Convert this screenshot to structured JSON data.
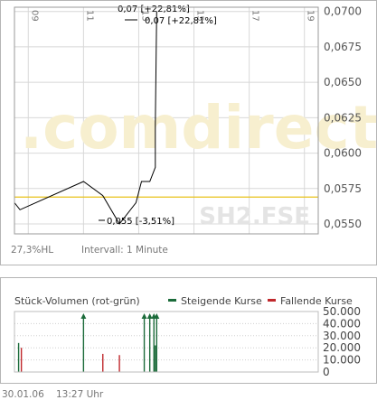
{
  "price_panel": {
    "watermark": ".comdirect",
    "symbol": "SH2.FSE",
    "hl_label": "27,3%HL",
    "interval_label": "Intervall: 1 Minute",
    "annotation_high_1": "0,07 [+22,81%]",
    "annotation_high_2": "0,07 [+22,81%]",
    "annotation_low": "0,055 [-3,51%]"
  },
  "volume_panel": {
    "title": "Stück-Volumen (rot-grün)",
    "legend_up": "Steigende Kurse",
    "legend_down": "Fallende Kurse"
  },
  "footer": {
    "date": "30.01.06",
    "time": "13:27 Uhr"
  },
  "colors": {
    "price_line": "#000000",
    "reference_line": "#e8c21a",
    "up": "#1b6b3a",
    "down": "#c0282c",
    "grid": "#d8d8d8",
    "frame": "#9a9a9a",
    "watermark_gold": "#f6ecc4",
    "watermark_gray": "#ebebeb"
  },
  "chart_data": [
    {
      "type": "line",
      "x_ticks": [
        "09",
        "11",
        "13",
        "15",
        "17",
        "19"
      ],
      "x_range": [
        8.5,
        19.5
      ],
      "y_ticks": [
        "0,0700",
        "0,0675",
        "0,0650",
        "0,0625",
        "0,0600",
        "0,0575",
        "0,0550"
      ],
      "ylim": [
        0.0543,
        0.0703
      ],
      "reference_value": 0.0569,
      "series": [
        {
          "x": [
            8.5,
            8.7,
            11.0,
            11.7,
            12.3,
            12.9,
            13.1,
            13.4,
            13.6,
            13.6,
            13.65
          ],
          "y": [
            0.0565,
            0.056,
            0.058,
            0.057,
            0.055,
            0.0565,
            0.058,
            0.058,
            0.059,
            0.062,
            0.07
          ]
        }
      ]
    },
    {
      "type": "bar",
      "y_ticks": [
        "50.000",
        "40.000",
        "30.000",
        "20.000",
        "10.000",
        "0"
      ],
      "ylim": [
        0,
        50000
      ],
      "bars": [
        {
          "x": 8.65,
          "value": 24000,
          "dir": "up"
        },
        {
          "x": 8.75,
          "value": 20000,
          "dir": "down"
        },
        {
          "x": 11.0,
          "value": 47000,
          "dir": "up"
        },
        {
          "x": 11.7,
          "value": 15000,
          "dir": "down"
        },
        {
          "x": 12.3,
          "value": 14000,
          "dir": "down"
        },
        {
          "x": 13.2,
          "value": 47000,
          "dir": "up"
        },
        {
          "x": 13.4,
          "value": 47000,
          "dir": "up"
        },
        {
          "x": 13.55,
          "value": 47000,
          "dir": "up"
        },
        {
          "x": 13.6,
          "value": 22000,
          "dir": "up"
        },
        {
          "x": 13.65,
          "value": 47000,
          "dir": "up"
        }
      ]
    }
  ]
}
